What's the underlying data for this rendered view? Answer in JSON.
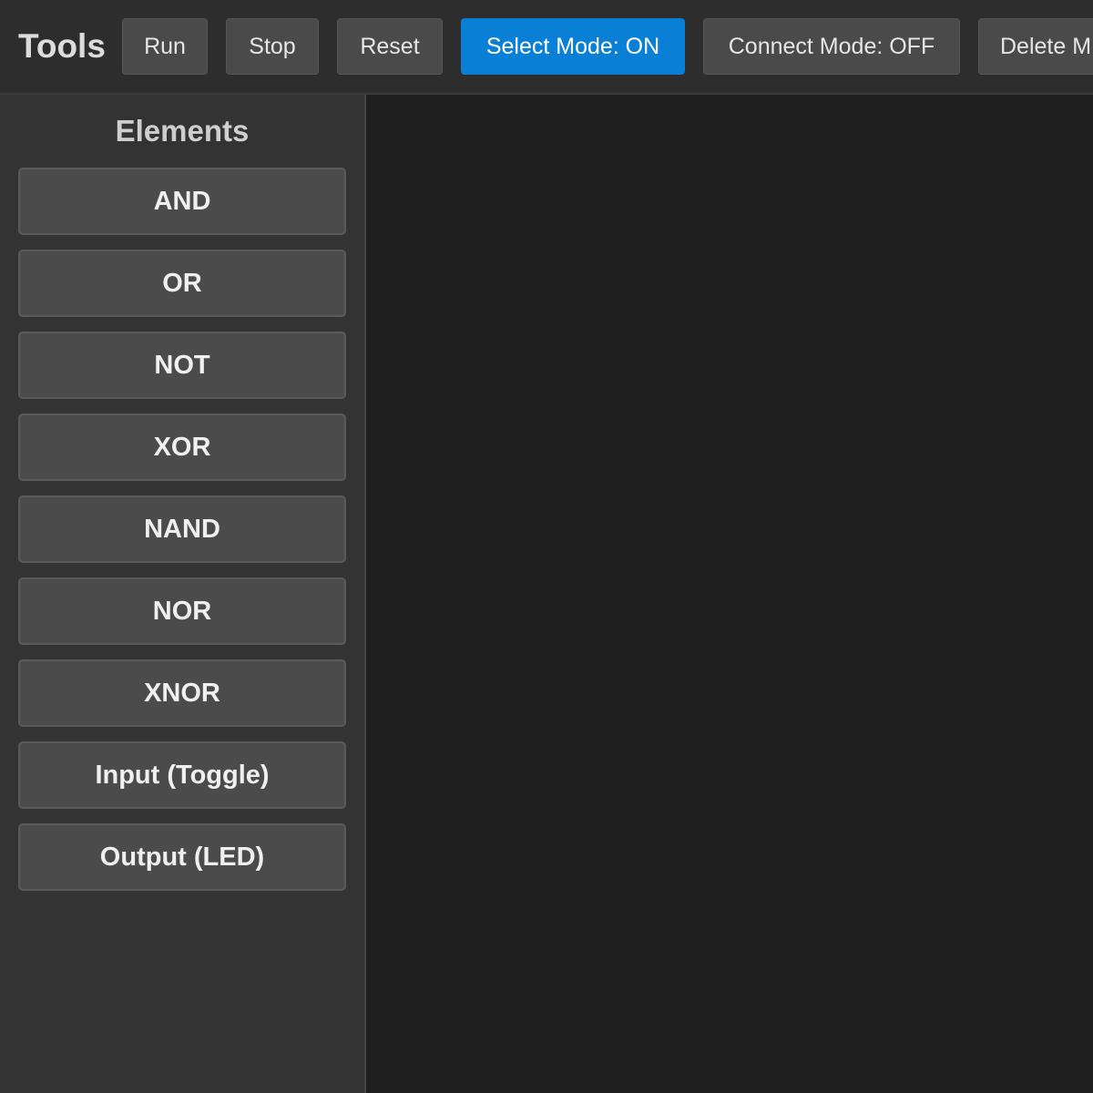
{
  "toolbar": {
    "title": "Tools",
    "buttons": {
      "run": "Run",
      "stop": "Stop",
      "reset": "Reset",
      "select_mode": "Select Mode: ON",
      "connect_mode": "Connect Mode: OFF",
      "delete_mode": "Delete M"
    },
    "active_button": "select_mode"
  },
  "sidebar": {
    "title": "Elements",
    "items": [
      {
        "label": "AND"
      },
      {
        "label": "OR"
      },
      {
        "label": "NOT"
      },
      {
        "label": "XOR"
      },
      {
        "label": "NAND"
      },
      {
        "label": "NOR"
      },
      {
        "label": "XNOR"
      },
      {
        "label": "Input (Toggle)"
      },
      {
        "label": "Output (LED)"
      }
    ]
  },
  "colors": {
    "accent": "#0a7fd6",
    "toolbar_bg": "#2d2d2d",
    "sidebar_bg": "#333333",
    "canvas_bg": "#1f1f1f",
    "button_bg": "#4a4a4a"
  }
}
